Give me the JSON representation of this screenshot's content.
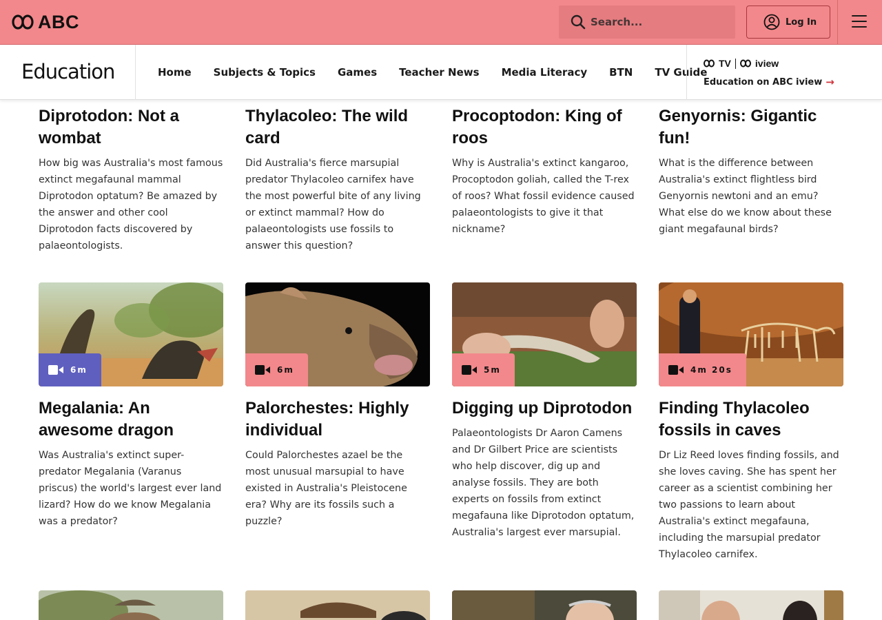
{
  "header": {
    "logo_text": "ABC",
    "search_placeholder": "Search...",
    "login_label": "Log In"
  },
  "subnav": {
    "brand": "Education",
    "links": [
      "Home",
      "Subjects & Topics",
      "Games",
      "Teacher News",
      "Media Literacy",
      "BTN",
      "TV Guide"
    ],
    "iview_logo_1": "TV",
    "iview_logo_2": "iview",
    "iview_promo": "Education on ABC iview"
  },
  "cards_row1": [
    {
      "title": "Diprotodon: Not a wombat",
      "description": "How big was Australia's most famous extinct megafaunal mammal Diprotodon optatum? Be amazed by the answer and other cool Diprotodon facts discovered by palaeontologists."
    },
    {
      "title": "Thylacoleo: The wild card",
      "description": "Did Australia's fierce marsupial predator Thylacoleo carnifex have the most powerful bite of any living or extinct mammal? How do palaeontologists use fossils to answer this question?"
    },
    {
      "title": "Procoptodon: King of roos",
      "description": "Why is Australia's extinct kangaroo, Procoptodon goliah, called the T-rex of roos? What fossil evidence caused palaeontologists to give it that nickname?"
    },
    {
      "title": "Genyornis: Gigantic fun!",
      "description": "What is the difference between Australia's extinct flightless bird Genyornis newtoni and an emu? What else do we know about these giant megafaunal birds?"
    }
  ],
  "cards_row2": [
    {
      "title": "Megalania: An awesome dragon",
      "duration": "6m",
      "description": "Was Australia's extinct super-predator Megalania (Varanus priscus) the world's largest ever land lizard? How do we know Megalania was a predator?",
      "badge_color": "#5f5fbf"
    },
    {
      "title": "Palorchestes: Highly individual",
      "duration": "6m",
      "description": "Could Palorchestes azael be the most unusual marsupial to have existed in Australia's Pleistocene era? Why are its fossils such a puzzle?",
      "badge_color": "#f2888b"
    },
    {
      "title": "Digging up Diprotodon",
      "duration": "5m",
      "description": "Palaeontologists Dr Aaron Camens and Dr Gilbert Price are scientists who help discover, dig up and analyse fossils. They are both experts on fossils from extinct megafauna like Diprotodon optatum, Australia's largest ever marsupial.",
      "badge_color": "#f2888b"
    },
    {
      "title": "Finding Thylacoleo fossils in caves",
      "duration": "4m 20s",
      "description": "Dr Liz Reed loves finding fossils, and she loves caving. She has spent her career as a scientist combining her two passions to learn about Australia's extinct megafauna, including the marsupial predator Thylacoleo carnifex.",
      "badge_color": "#f2888b"
    }
  ],
  "colors": {
    "topbar": "#f2888b",
    "accent_red": "#d1333b",
    "badge_blue": "#5f5fbf"
  }
}
